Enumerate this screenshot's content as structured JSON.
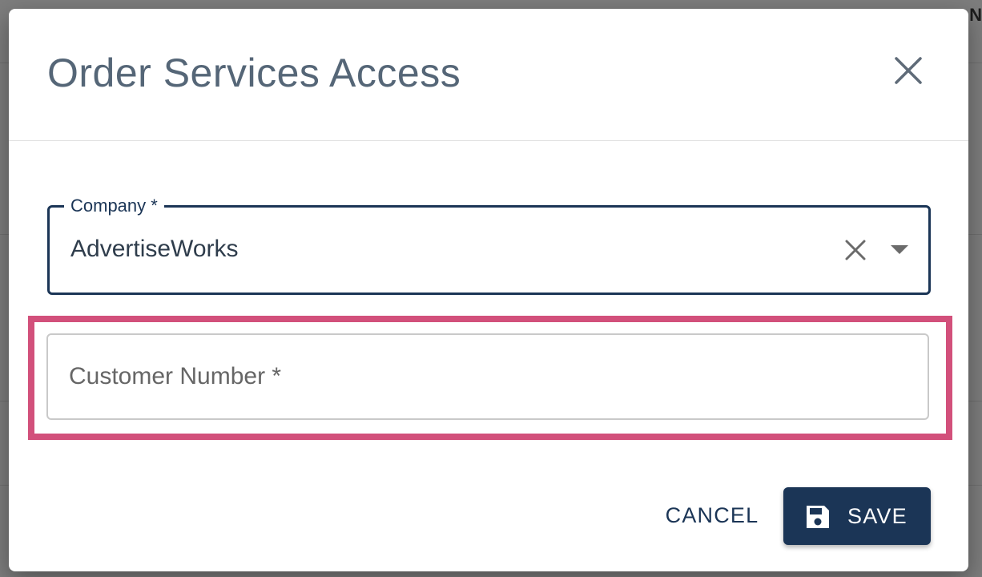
{
  "background": {
    "corner_text": "N"
  },
  "dialog": {
    "title": "Order Services Access",
    "close_icon": "close-icon"
  },
  "company_field": {
    "label": "Company *",
    "value": "AdvertiseWorks",
    "clear_icon": "close-icon",
    "dropdown_icon": "caret-down-icon"
  },
  "customer_number_field": {
    "placeholder": "Customer Number *",
    "value": ""
  },
  "actions": {
    "cancel_label": "CANCEL",
    "save_label": "SAVE",
    "save_icon": "floppy-disk-icon"
  },
  "colors": {
    "primary": "#1b3556",
    "title": "#556677",
    "highlight": "#d2507b",
    "backdrop": "#7d7d7d"
  }
}
